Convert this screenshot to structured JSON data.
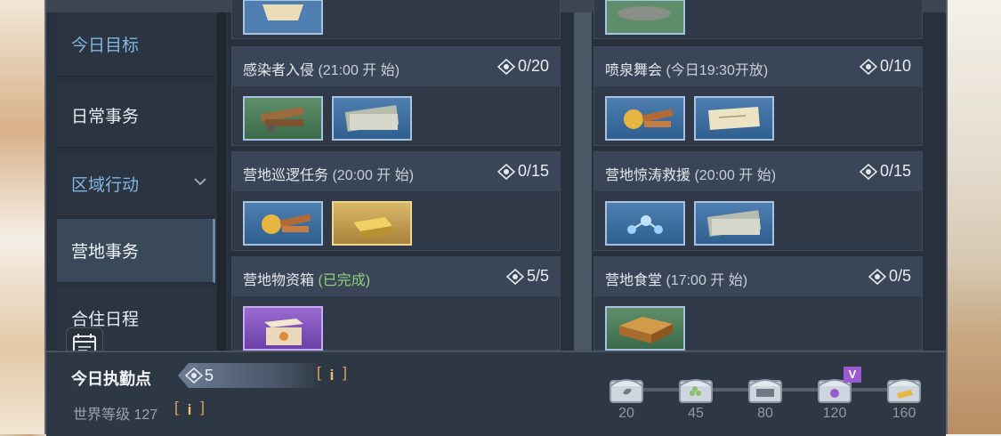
{
  "sidebar": {
    "items": [
      {
        "label": "今日目标",
        "state": "highlight"
      },
      {
        "label": "日常事务",
        "state": "normal"
      },
      {
        "label": "区域行动",
        "state": "highlight",
        "expandable": true
      },
      {
        "label": "营地事务",
        "state": "active"
      },
      {
        "label": "合住日程",
        "state": "normal"
      }
    ],
    "calendar_icon": "calendar-icon"
  },
  "tasks": [
    {
      "title": "感染者入侵",
      "time": "(21:00 开 始)",
      "count": "0/20",
      "rewards": [
        "building-materials",
        "cash-bundle"
      ]
    },
    {
      "title": "喷泉舞会",
      "time": "(今日19:30开放)",
      "count": "0/10",
      "rewards": [
        "medal-planks",
        "letter-envelope"
      ]
    },
    {
      "title": "营地巡逻任务",
      "time": "(20:00 开 始)",
      "count": "0/15",
      "rewards": [
        "medal-planks",
        "gold-bars"
      ]
    },
    {
      "title": "营地惊涛救援",
      "time": "(20:00 开 始)",
      "count": "0/15",
      "rewards": [
        "molecule",
        "cash-bundle"
      ]
    },
    {
      "title": "营地物资箱",
      "time": "(已完成)",
      "count": "5/5",
      "done": true,
      "rewards": [
        "supply-box"
      ]
    },
    {
      "title": "营地食堂",
      "time": "(17:00 开 始)",
      "count": "0/5",
      "rewards": [
        "pizza-food"
      ]
    }
  ],
  "bottom": {
    "duty_label": "今日执勤点",
    "duty_value": "5",
    "info_glyph": "i",
    "world_level": "世界等级 127",
    "milestones": [
      {
        "value": "20",
        "icon": "chest-leaf-icon"
      },
      {
        "value": "45",
        "icon": "chest-pile-icon"
      },
      {
        "value": "80",
        "icon": "chest-exp-icon"
      },
      {
        "value": "120",
        "icon": "chest-vip-icon",
        "badge": "V"
      },
      {
        "value": "160",
        "icon": "chest-gold-icon"
      }
    ]
  },
  "colors": {
    "panel": "#27303c",
    "sidebar_highlight": "#7fb7e0",
    "done_green": "#8fd07a",
    "info_orange": "#e0a25a"
  }
}
